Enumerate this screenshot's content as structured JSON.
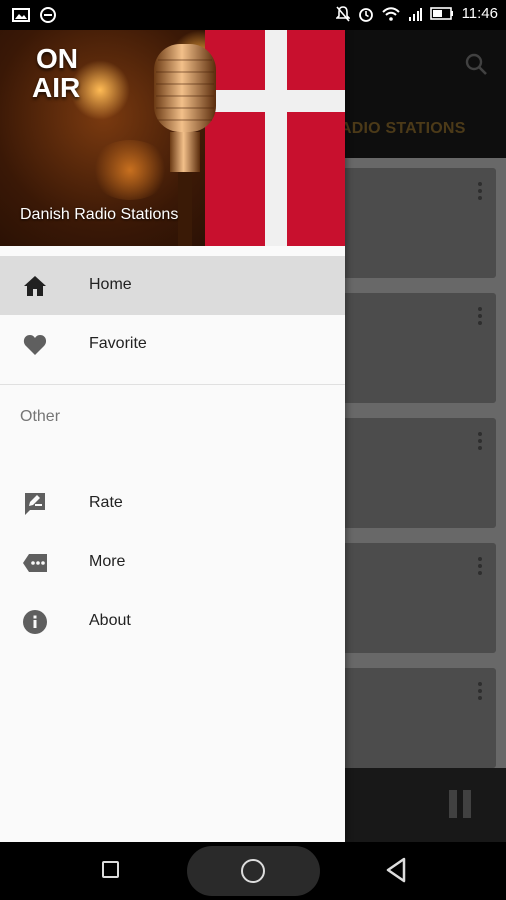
{
  "status_bar": {
    "time": "11:46",
    "icons": [
      "image-icon",
      "minus-circle-icon",
      "mute-icon",
      "alarm-icon",
      "wifi-icon",
      "signal-icon",
      "battery-icon"
    ]
  },
  "app": {
    "title_partial": "ADIO STATIONS",
    "search_icon": "search-icon",
    "card_count": 5,
    "player_icon": "pause-icon"
  },
  "drawer": {
    "header": {
      "badge_line1": "ON",
      "badge_line2": "AIR",
      "title": "Danish Radio Stations"
    },
    "items": [
      {
        "label": "Home",
        "icon": "home-icon",
        "active": true
      },
      {
        "label": "Favorite",
        "icon": "heart-icon",
        "active": false
      }
    ],
    "section_label": "Other",
    "other_items": [
      {
        "label": "Rate",
        "icon": "rate-icon"
      },
      {
        "label": "More",
        "icon": "more-tag-icon"
      },
      {
        "label": "About",
        "icon": "info-icon"
      }
    ]
  },
  "colors": {
    "drawer_bg": "#fafafa",
    "active_item_bg": "#dcdcdc",
    "icon_color": "#5f5f5f",
    "flag_red": "#c8102e",
    "title_accent": "#8a6a2c"
  },
  "nav_bar": {
    "buttons": [
      "recents-button",
      "home-button",
      "back-button"
    ]
  }
}
